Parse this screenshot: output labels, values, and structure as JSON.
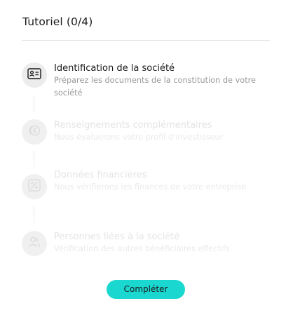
{
  "header": {
    "title": "Tutoriel (0/4)"
  },
  "steps": [
    {
      "label": "Identification de la société",
      "description": "Préparez les documents de la constitution de votre société",
      "icon": "id-card-icon",
      "state": "active"
    },
    {
      "label": "Renseignements complémentaires",
      "description": "Nous évaluerons votre profil d'investisseur",
      "icon": "euro-coins-icon",
      "state": "inactive"
    },
    {
      "label": "Données financières",
      "description": "Nous vérifierons les finances de votre entreprise",
      "icon": "finance-chart-icon",
      "state": "inactive"
    },
    {
      "label": "Personnes liées à la société",
      "description": "Vérification des autres bénéficiaires effectifs",
      "icon": "people-icon",
      "state": "inactive"
    }
  ],
  "actions": {
    "complete_label": "Compléter"
  },
  "colors": {
    "accent": "#1ad8d0",
    "text_dark": "#1a1a1a",
    "text_muted": "#9a9a9a",
    "text_disabled": "#e4e4e4"
  }
}
